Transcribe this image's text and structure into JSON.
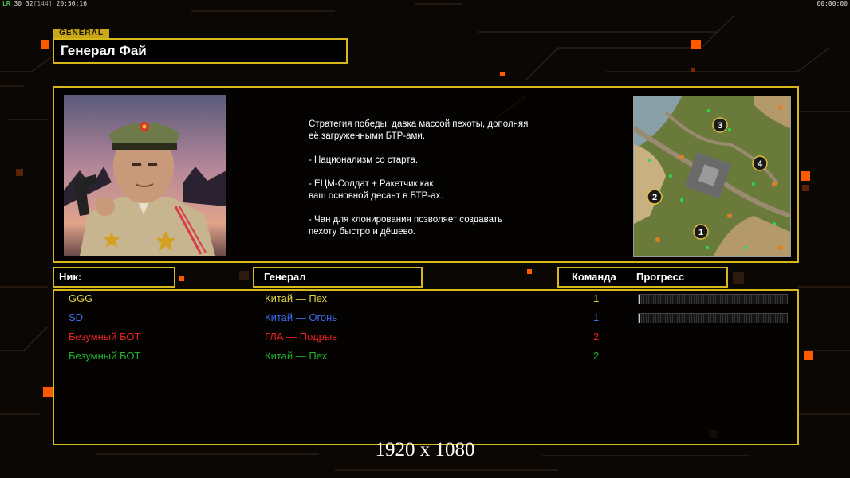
{
  "hud": {
    "left_tag": "LR",
    "left_a": "30",
    "left_b": "32",
    "left_c": "[144]",
    "clock": "20:50:16",
    "timer": "00:00:00"
  },
  "header": {
    "badge": "GENERAL",
    "general_name": "Генерал Фай"
  },
  "description": "Стратегия победы: давка массой пехоты, дополняя\n её загруженными БТР-ами.\n\n- Национализм со старта.\n\n- ЕЦМ-Солдат + Ракетчик как\nваш основной десант в БТР-ах.\n\n- Чан для клонирования позволяет создавать\n пехоту быстро и дёшево.",
  "map": {
    "start_positions": [
      "1",
      "2",
      "3",
      "4"
    ]
  },
  "columns": {
    "nick": "Ник:",
    "general": "Генерал",
    "team": "Команда",
    "progress": "Прогресс"
  },
  "players": [
    {
      "nick": "GGG",
      "general": "Китай — Пех",
      "team": "1",
      "color": "#e0d048",
      "progress": 0.01
    },
    {
      "nick": "SD",
      "general": "Китай — Огонь",
      "team": "1",
      "color": "#3c6cf0",
      "progress": 0.005
    },
    {
      "nick": "Безумный БОТ",
      "general": "ГЛА — Подрыв",
      "team": "2",
      "color": "#e82020",
      "progress": null
    },
    {
      "nick": "Безумный БОТ",
      "general": "Китай — Пех",
      "team": "2",
      "color": "#20b030",
      "progress": null
    }
  ],
  "resolution_caption": "1920 x 1080",
  "colors": {
    "accent": "#d6b81c",
    "orange": "#ff6a10"
  }
}
